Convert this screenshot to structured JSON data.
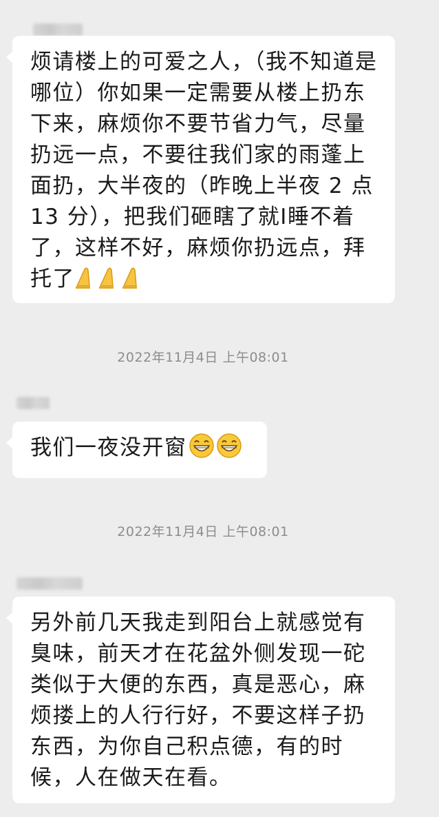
{
  "messages": [
    {
      "text": "烦请楼上的可爱之人，（我不知道是哪位）你如果一定需要从楼上扔东下来，麻烦你不要节省力气，尽量扔远一点，不要往我们家的雨蓬上面扔，大半夜的（昨晚上半夜 2 点 13 分），把我们砸瞎了就I睡不着了，这样不好，麻烦你扔远点，拜托了",
      "emojis": [
        "pray-icon",
        "pray-icon",
        "pray-icon"
      ]
    },
    {
      "timestamp": "2022年11月4日 上午08:01",
      "text": "我们一夜没开窗",
      "emojis": [
        "grin-icon",
        "grin-icon"
      ]
    },
    {
      "timestamp": "2022年11月4日 上午08:01",
      "text": "另外前几天我走到阳台上就感觉有臭味，前天才在花盆外侧发现一砣类似于大便的东西，真是恶心，麻烦搂上的人行行好，不要这样子扔东西，为你自己积点德，有的时候，人在做天在看。"
    }
  ],
  "colors": {
    "background": "#ededed",
    "bubble": "#ffffff",
    "text": "#1a1a1a",
    "timestamp": "#8c8c8c"
  }
}
